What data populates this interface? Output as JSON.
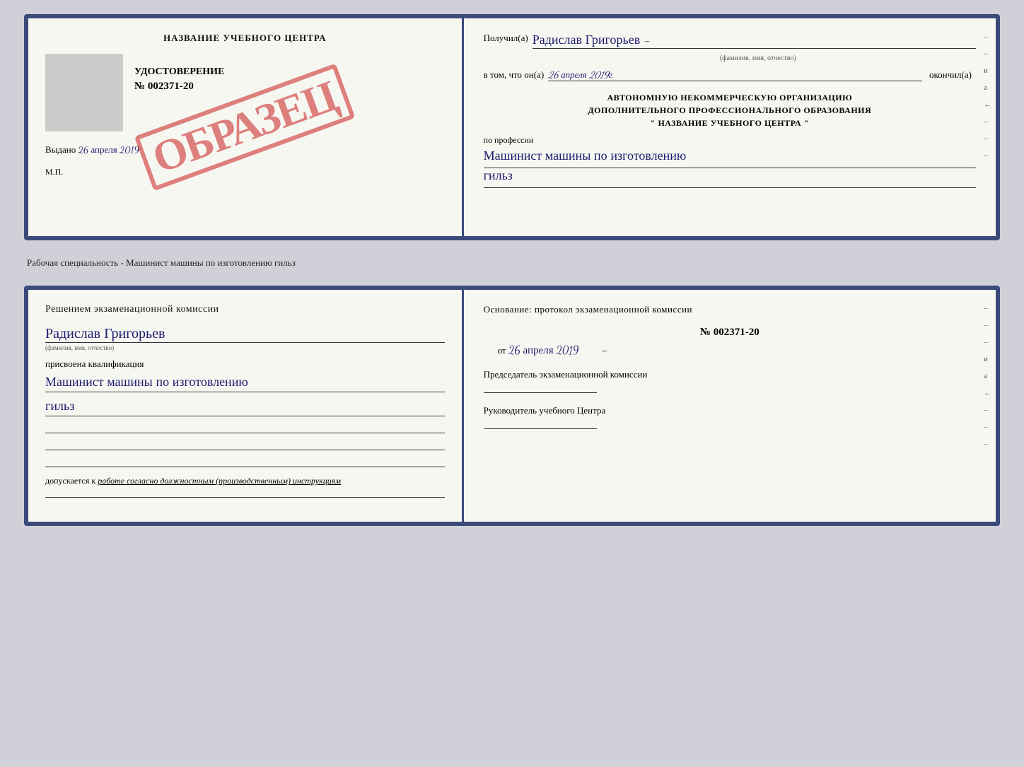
{
  "page": {
    "background": "#d0d0d8"
  },
  "certificate": {
    "left": {
      "title": "НАЗВАНИЕ УЧЕБНОГО ЦЕНТРА",
      "udostoverenie_label": "УДОСТОВЕРЕНИЕ",
      "number": "№ 002371-20",
      "vydano_label": "Выдано",
      "vydano_date": "26 апреля 2019",
      "mp_label": "М.П.",
      "stamp_text": "ОБРАЗЕЦ"
    },
    "right": {
      "poluchil_label": "Получил(а)",
      "recipient_name": "Радислав Григорьев",
      "fio_sublabel": "(фамилия, имя, отчество)",
      "vtom_label": "в том, что он(а)",
      "date_value": "26 апреля 2019г.",
      "okonchil_label": "окончил(а)",
      "org_line1": "АВТОНОМНУЮ НЕКОММЕРЧЕСКУЮ ОРГАНИЗАЦИЮ",
      "org_line2": "ДОПОЛНИТЕЛЬНОГО ПРОФЕССИОНАЛЬНОГО ОБРАЗОВАНИЯ",
      "org_name": "\"   НАЗВАНИЕ УЧЕБНОГО ЦЕНТРА   \"",
      "po_professii_label": "по профессии",
      "profession_value": "Машинист машины по изготовлению",
      "profession_value2": "гильз",
      "side_marks": [
        "–",
        "–",
        "и",
        "а",
        "←",
        "–",
        "–",
        "–"
      ]
    }
  },
  "separator": {
    "text": "Рабочая специальность - Машинист машины по изготовлению гильз"
  },
  "qualification": {
    "left": {
      "heading": "Решением  экзаменационной  комиссии",
      "name": "Радислав Григорьев",
      "fio_sublabel": "(фамилия, имя, отчество)",
      "prisvoena_label": "присвоена квалификация",
      "profession_value": "Машинист машины по изготовлению",
      "profession_value2": "гильз",
      "dopuskaetsya_label": "допускается к",
      "dopuskaetsya_value": "работе согласно должностным (производственным) инструкциям"
    },
    "right": {
      "heading": "Основание: протокол экзаменационной  комиссии",
      "number": "№  002371-20",
      "ot_label": "от",
      "date_value": "26 апреля 2019",
      "chairman_label": "Председатель экзаменационной комиссии",
      "head_label": "Руководитель учебного Центра",
      "side_marks": [
        "–",
        "–",
        "–",
        "и",
        "а",
        "←",
        "–",
        "–",
        "–"
      ]
    }
  }
}
